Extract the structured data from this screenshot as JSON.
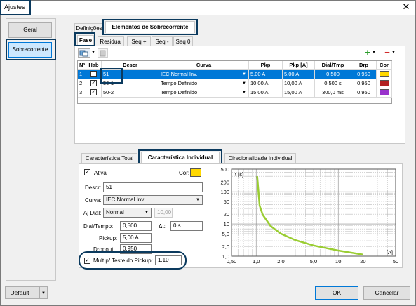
{
  "window": {
    "title": "Ajustes",
    "close_glyph": "✕"
  },
  "left_nav": {
    "items": [
      {
        "label": "Geral"
      },
      {
        "label": "Sobrecorrente"
      }
    ]
  },
  "top_tabs": [
    {
      "label": "Definições"
    },
    {
      "label": "Elementos de Sobrecorrente"
    }
  ],
  "sub_tabs": [
    {
      "label": "Fase"
    },
    {
      "label": "Residual"
    },
    {
      "label": "Seq +"
    },
    {
      "label": "Seq -"
    },
    {
      "label": "Seq 0"
    }
  ],
  "toolbar": {
    "add_glyph": "+",
    "remove_glyph": "−",
    "dropdown_glyph": "▼"
  },
  "table": {
    "headers": [
      "Nº",
      "Hab",
      "Descr",
      "Curva",
      "Pkp",
      "Pkp [A]",
      "Dial/Tmp",
      "Drp",
      "Cor"
    ],
    "rows": [
      {
        "n": "1",
        "descr": "51",
        "curva": "IEC Normal Inv.",
        "pkp": "5,00 A",
        "pkpa": "5,00 A",
        "dial": "0,500",
        "drp": "0,950",
        "color": "#ffd800"
      },
      {
        "n": "2",
        "descr": "50-1",
        "curva": "Tempo Definido",
        "pkp": "10,00 A",
        "pkpa": "10,00 A",
        "dial": "0,500 s",
        "drp": "0,950",
        "color": "#b22222"
      },
      {
        "n": "3",
        "descr": "50-2",
        "curva": "Tempo Definido",
        "pkp": "15,00 A",
        "pkpa": "15,00 A",
        "dial": "300,0 ms",
        "drp": "0,950",
        "color": "#9932cc"
      }
    ]
  },
  "detail_tabs": [
    {
      "label": "Característica Total"
    },
    {
      "label": "Característica Individual"
    },
    {
      "label": "Direcionalidade Individual"
    }
  ],
  "form": {
    "ativa_label": "Ativa",
    "cor_label": "Cor:",
    "cor_value": "#ffd800",
    "descr_label": "Descr:",
    "descr_value": "51",
    "curva_label": "Curva:",
    "curva_value": "IEC Normal Inv.",
    "aj_dial_label": "Aj Dial:",
    "aj_dial_value": "Normal",
    "aj_dial_extra": "10,00",
    "dial_label": "Dial/Tempo:",
    "dial_value": "0,500",
    "dt_label": "Δt:",
    "dt_value": "0 s",
    "pickup_label": "Pickup:",
    "pickup_value": "5,00 A",
    "dropout_label": "Dropout:",
    "dropout_value": "0,950",
    "mult_label": "Mult p/ Teste do Pickup:",
    "mult_value": "1,10"
  },
  "chart_data": {
    "type": "line",
    "xscale": "log",
    "yscale": "log",
    "xlim": [
      0.5,
      50
    ],
    "ylim": [
      1.0,
      500
    ],
    "x_ticks": [
      "0,50",
      "1,0",
      "2,0",
      "5,0",
      "10",
      "20",
      "50"
    ],
    "y_ticks": [
      "500",
      "200",
      "100",
      "50",
      "20",
      "10",
      "5,0",
      "2,0",
      "1,0"
    ],
    "ylabel": "t [s]",
    "xlabel": "I [A]",
    "grid": true,
    "series": [
      {
        "color": "#9acd32",
        "x": [
          1.03,
          1.1,
          1.2,
          1.5,
          2.0,
          3.0,
          5.0,
          10.0,
          20.0
        ],
        "y": [
          300,
          37,
          19.3,
          8.6,
          5.0,
          3.15,
          2.14,
          1.49,
          1.12
        ]
      }
    ]
  },
  "footer": {
    "default_label": "Default",
    "ok_label": "OK",
    "cancel_label": "Cancelar"
  }
}
